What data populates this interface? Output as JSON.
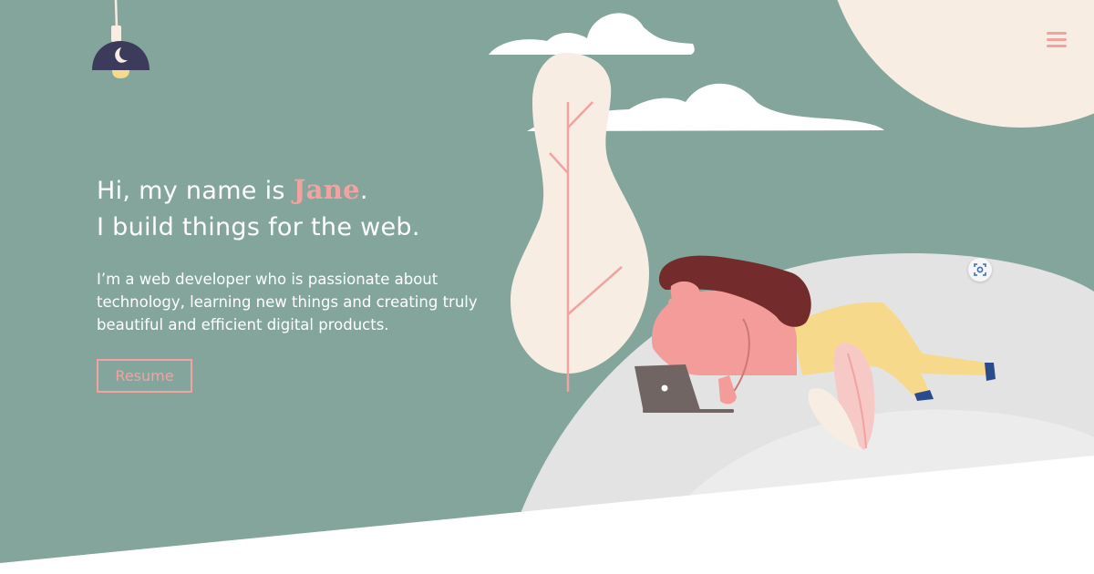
{
  "header": {
    "menu_icon": "hamburger-menu-icon",
    "lamp_icon": "hanging-lamp-icon"
  },
  "hero": {
    "greeting_prefix": "Hi, my name is ",
    "name": "Jane",
    "greeting_suffix": ".",
    "tagline": "I build things for the web.",
    "intro": "I’m a web developer who is passionate about technology, learning new things and creating truly beautiful and efficient digital products.",
    "resume_label": "Resume"
  },
  "overlay": {
    "lens_icon": "visual-search-icon"
  },
  "colors": {
    "background": "#84a59c",
    "accent": "#f1a3a0",
    "text": "#ffffff",
    "moon": "#f8ede3",
    "hill": "#e3e3e3"
  }
}
